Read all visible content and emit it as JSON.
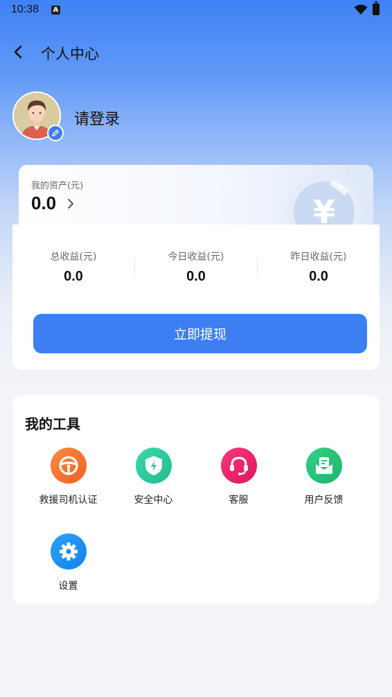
{
  "status_bar": {
    "time": "10:38",
    "notification_letter": "A"
  },
  "nav": {
    "title": "个人中心"
  },
  "profile": {
    "login_text": "请登录"
  },
  "assets": {
    "label": "我的资产(元)",
    "value": "0.0",
    "coin_symbol": "¥"
  },
  "stats": [
    {
      "label": "总收益(元)",
      "value": "0.0"
    },
    {
      "label": "今日收益(元)",
      "value": "0.0"
    },
    {
      "label": "昨日收益(元)",
      "value": "0.0"
    }
  ],
  "withdraw_label": "立即提现",
  "tools": {
    "title": "我的工具",
    "items": [
      {
        "label": "救援司机认证",
        "icon": "steering-wheel-icon",
        "color": "#f4722b"
      },
      {
        "label": "安全中心",
        "icon": "shield-icon",
        "color": "#2fc99f"
      },
      {
        "label": "客服",
        "icon": "headset-icon",
        "color": "#f0256f"
      },
      {
        "label": "用户反馈",
        "icon": "feedback-mail-icon",
        "color": "#23c27a"
      },
      {
        "label": "设置",
        "icon": "gear-icon",
        "color": "#1e8ff5"
      }
    ]
  },
  "colors": {
    "primary": "#3d7ff3",
    "page_bg": "#f3f4f7"
  }
}
